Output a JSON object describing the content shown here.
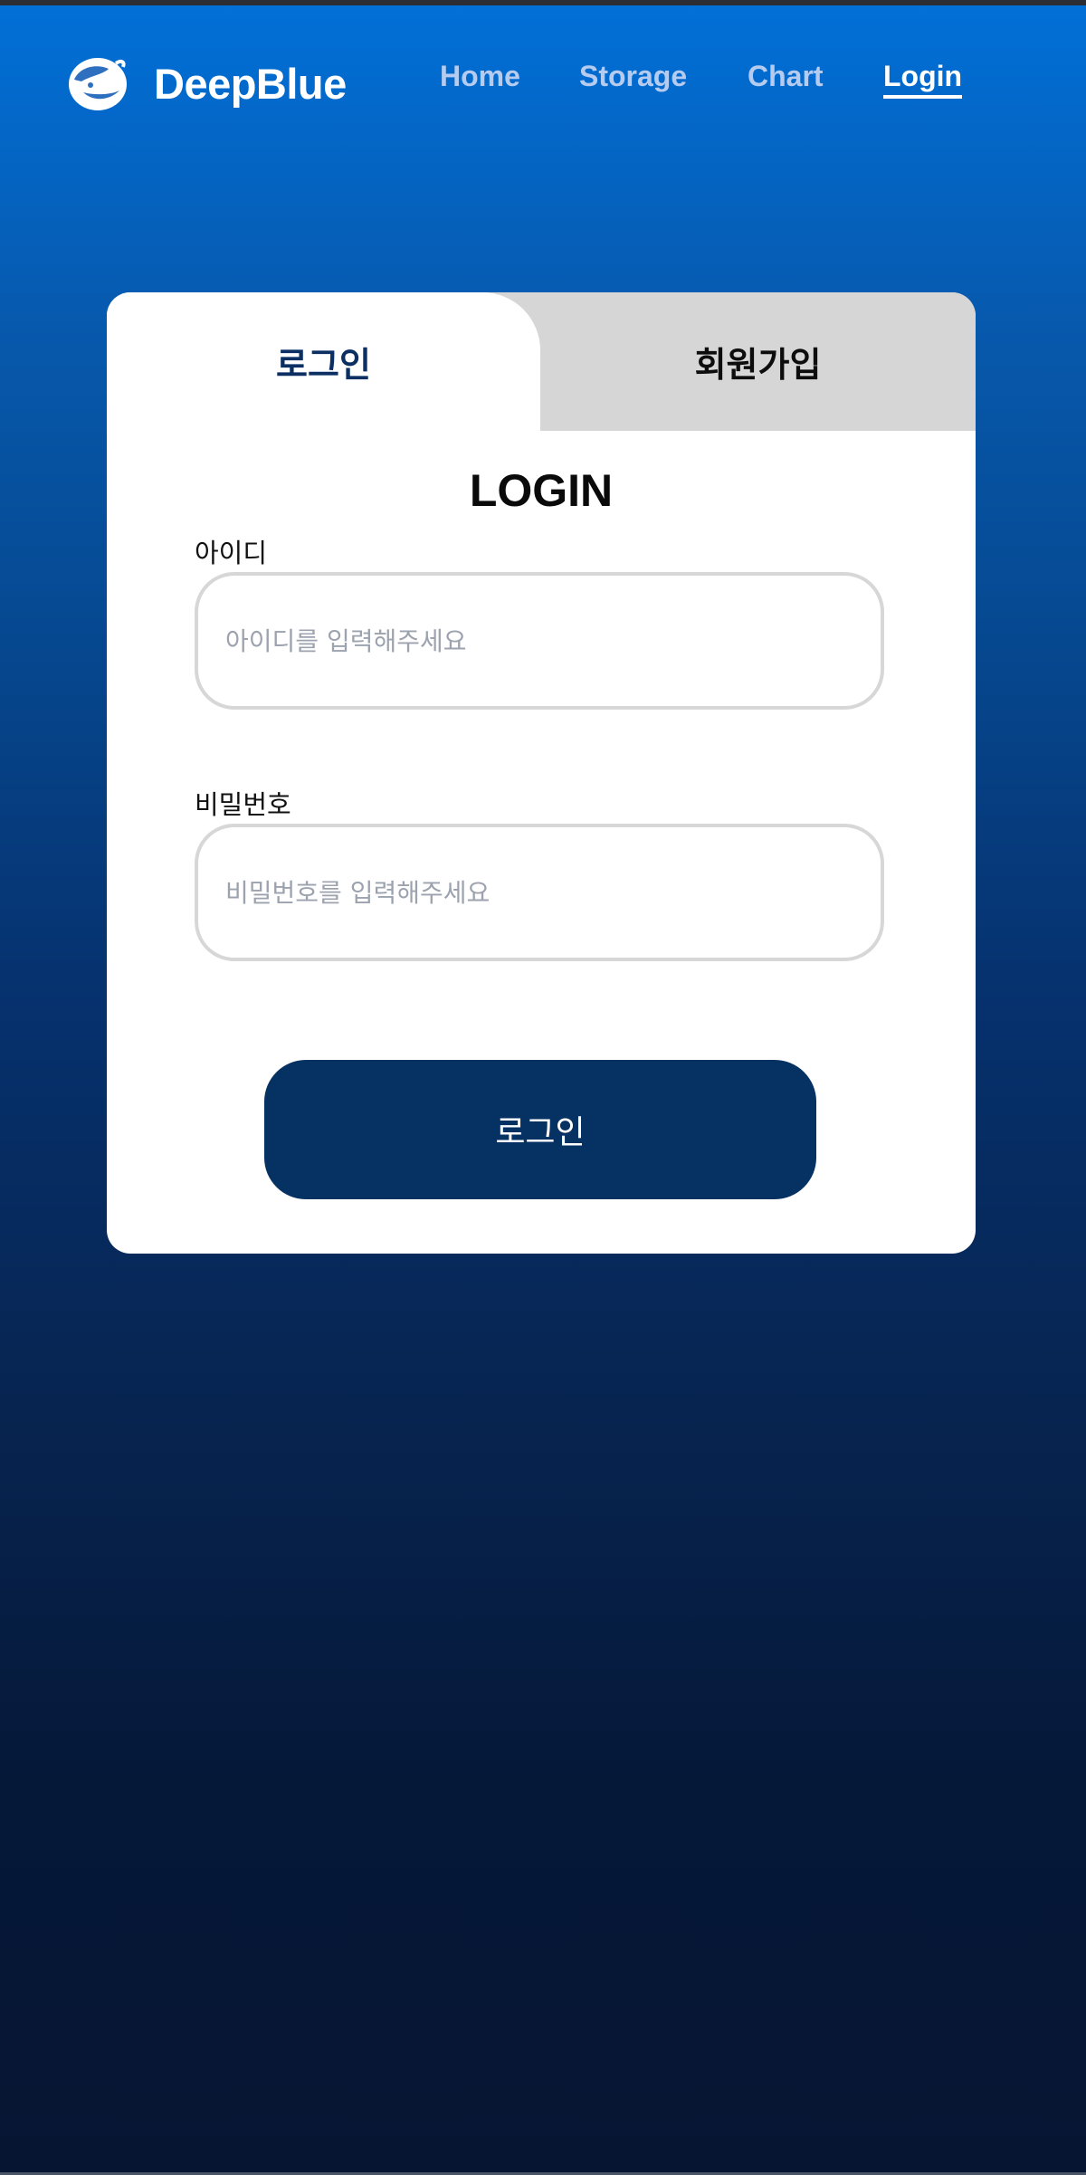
{
  "header": {
    "brand": "DeepBlue",
    "logo_icon": "whale-logo-icon",
    "nav": [
      {
        "label": "Home",
        "active": false
      },
      {
        "label": "Storage",
        "active": false
      },
      {
        "label": "Chart",
        "active": false
      },
      {
        "label": "Login",
        "active": true
      }
    ]
  },
  "card": {
    "tabs": [
      {
        "label": "로그인",
        "active": true
      },
      {
        "label": "회원가입",
        "active": false
      }
    ],
    "title": "LOGIN",
    "id_field": {
      "label": "아이디",
      "placeholder": "아이디를 입력해주세요",
      "value": ""
    },
    "password_field": {
      "label": "비밀번호",
      "placeholder": "비밀번호를 입력해주세요",
      "value": ""
    },
    "submit_label": "로그인"
  },
  "colors": {
    "accent": "#063263",
    "active_tab_text": "#0b2e63",
    "inactive_tab_bg": "#d6d6d6",
    "nav_inactive": "#b5ccf0"
  }
}
